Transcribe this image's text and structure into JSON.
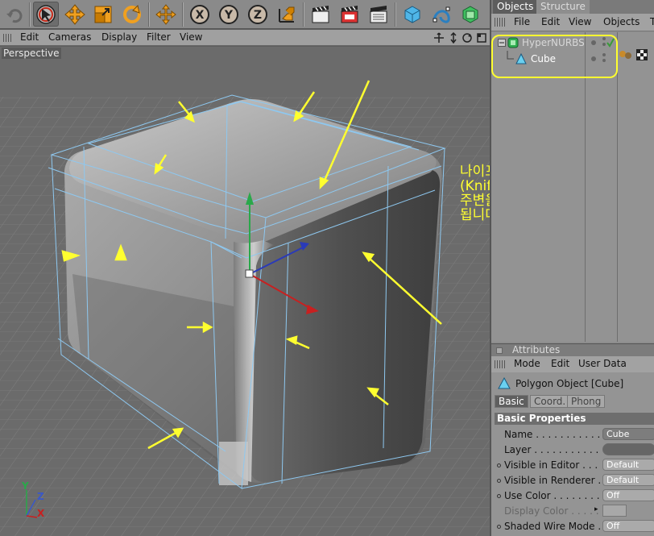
{
  "toolbar": {
    "buttons": [
      "undo-icon",
      "live-selection-icon",
      "move-icon",
      "scale-icon",
      "rotate-icon",
      "world-axis-icon",
      "x-axis-icon",
      "y-axis-icon",
      "z-axis-icon",
      "coordinate-system-icon",
      "render-view-icon",
      "render-picture-viewer-icon",
      "render-settings-icon",
      "cube-primitive-icon",
      "spline-icon",
      "nurbs-icon"
    ],
    "axis_letters": [
      "X",
      "Y",
      "Z"
    ]
  },
  "viewport_menu": {
    "items": [
      "Edit",
      "Cameras",
      "Display",
      "Filter",
      "View"
    ]
  },
  "viewport": {
    "label": "Perspective",
    "annotation": "나이프 명령어\n(Knife-Loop모드)로\n주변을 짤라주시면\n됩니다.",
    "axis_labels": {
      "y": "Y",
      "z": "Z",
      "x": "X"
    },
    "annotation_color": "#ffff30"
  },
  "object_manager": {
    "tabs": [
      "Objects",
      "Structure"
    ],
    "menu": [
      "File",
      "Edit",
      "View",
      "Objects",
      "T"
    ],
    "items": [
      {
        "label": "HyperNURBS",
        "icon": "hypernurbs-icon"
      },
      {
        "label": "Cube",
        "icon": "polygon-object-icon"
      }
    ]
  },
  "attributes": {
    "header": "Attributes",
    "menu": [
      "Mode",
      "Edit",
      "User Data"
    ],
    "object_title": "Polygon Object [Cube]",
    "tabs": [
      "Basic",
      "Coord.",
      "Phong"
    ],
    "section": "Basic Properties",
    "properties": [
      {
        "label": "Name . . . . . . . . . . . . .",
        "value": "Cube",
        "bullet": false
      },
      {
        "label": "Layer . . . . . . . . . . . . .",
        "value": "",
        "bullet": false
      },
      {
        "label": "Visible in Editor . . . . . .",
        "value": "Default",
        "bullet": true
      },
      {
        "label": "Visible in Renderer . . . .",
        "value": "Default",
        "bullet": true
      },
      {
        "label": "Use Color . . . . . . . . . .",
        "value": "Off",
        "bullet": true
      },
      {
        "label": "Display Color . . . . . . . .",
        "value": "",
        "bullet": false,
        "dim": true
      },
      {
        "label": "Shaded Wire Mode . . . .",
        "value": "Off",
        "bullet": true
      }
    ]
  }
}
